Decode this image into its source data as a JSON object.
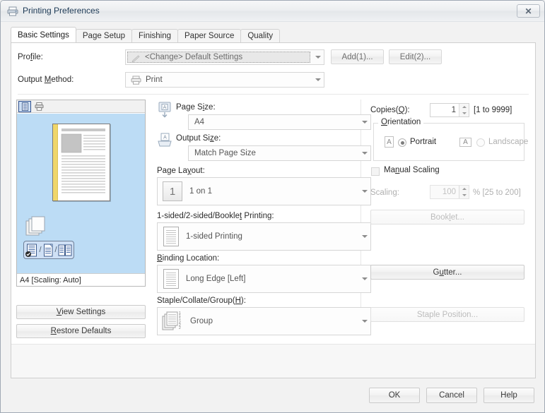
{
  "window": {
    "title": "Printing Preferences",
    "title_icon": "printer-icon",
    "close_label": "✕"
  },
  "tabs": [
    {
      "label": "Basic Settings",
      "active": true
    },
    {
      "label": "Page Setup",
      "active": false
    },
    {
      "label": "Finishing",
      "active": false
    },
    {
      "label": "Paper Source",
      "active": false
    },
    {
      "label": "Quality",
      "active": false
    }
  ],
  "profile": {
    "label": "Profile:",
    "value": "<Change> Default Settings",
    "icon": "pencil-icon",
    "add_button": "Add(1)...",
    "edit_button": "Edit(2)..."
  },
  "output_method": {
    "label": "Output Method:",
    "value": "Print",
    "icon": "printer-icon"
  },
  "preview": {
    "toolbar": [
      {
        "name": "page-preview-toggle",
        "selected": true
      },
      {
        "name": "printer-preview-toggle",
        "selected": false
      }
    ],
    "status": "A4 [Scaling: Auto]",
    "background_color": "#bcdcf5",
    "binding_color": "#f0d66a"
  },
  "left_buttons": {
    "view_settings": "View Settings",
    "restore_defaults": "Restore Defaults"
  },
  "settings": {
    "page_size": {
      "label": "Page Size:",
      "value": "A4",
      "icon": "page-size-icon"
    },
    "output_size": {
      "label": "Output Size:",
      "value": "Match Page Size",
      "icon": "output-size-icon"
    },
    "page_layout": {
      "label": "Page Layout:",
      "value": "1 on 1",
      "icon": "layout-1up-icon"
    },
    "duplex": {
      "label": "1-sided/2-sided/Booklet Printing:",
      "value": "1-sided Printing",
      "icon": "document-icon"
    },
    "binding": {
      "label": "Binding Location:",
      "value": "Long Edge [Left]",
      "icon": "document-icon"
    },
    "staple": {
      "label": "Staple/Collate/Group(H):",
      "value": "Group",
      "icon": "group-icon"
    }
  },
  "right_panel": {
    "copies": {
      "label": "Copies(Q):",
      "value": "1",
      "range": "[1 to 9999]"
    },
    "orientation": {
      "title": "Orientation",
      "portrait": {
        "label": "Portrait",
        "selected": true
      },
      "landscape": {
        "label": "Landscape",
        "selected": false
      },
      "icon_letter": "A"
    },
    "manual_scaling": {
      "label": "Manual Scaling",
      "checked": false
    },
    "scaling": {
      "label": "Scaling:",
      "value": "100",
      "unit": "%",
      "range": "[25 to 200]",
      "disabled": true
    },
    "booklet_button": {
      "label": "Booklet...",
      "disabled": true
    },
    "gutter_button": {
      "label": "Gutter...",
      "disabled": false
    },
    "staple_position_button": {
      "label": "Staple Position...",
      "disabled": true
    }
  },
  "footer": {
    "ok": "OK",
    "cancel": "Cancel",
    "help": "Help"
  }
}
